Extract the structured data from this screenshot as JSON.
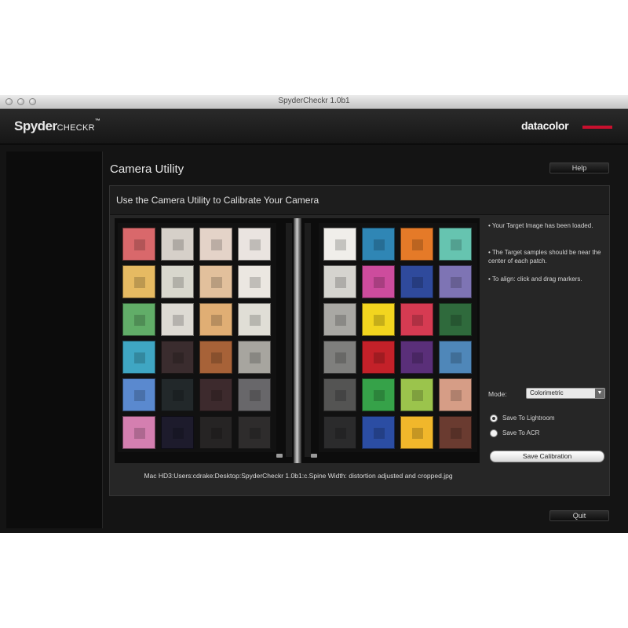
{
  "window": {
    "title": "SpyderCheckr 1.0b1"
  },
  "header": {
    "brand_main": "Spyder",
    "brand_suffix": "CHECKR",
    "brand_tm": "™",
    "vendor": "datacolor"
  },
  "page": {
    "title": "Camera Utility",
    "help_label": "Help",
    "quit_label": "Quit"
  },
  "panel": {
    "title": "Use the Camera Utility to Calibrate Your Camera",
    "file_path": "Mac HD3:Users:cdrake:Desktop:SpyderCheckr 1.0b1:c.Spine Width: distortion adjusted and cropped.jpg"
  },
  "instructions": [
    "• Your Target Image has been loaded.",
    "• The Target samples should be near the center of each patch.",
    "• To align: click and drag markers."
  ],
  "controls": {
    "mode_label": "Mode:",
    "mode_value": "Colorimetric",
    "radio_options": [
      {
        "label": "Save To Lightroom",
        "selected": true
      },
      {
        "label": "Save To ACR",
        "selected": false
      }
    ],
    "save_label": "Save Calibration"
  },
  "colors": {
    "chart_left": [
      [
        "#d9686b",
        "#d6d0c9",
        "#e4d3c8",
        "#eae4e0"
      ],
      [
        "#e6ba62",
        "#d8d7cd",
        "#e2c09c",
        "#ebe7e1"
      ],
      [
        "#61ad68",
        "#dddad3",
        "#e0ae74",
        "#e0ded6"
      ],
      [
        "#3fa6c3",
        "#3a2c2e",
        "#a76238",
        "#a7a59f"
      ],
      [
        "#5a89cf",
        "#22282a",
        "#3d2a2d",
        "#68676a"
      ],
      [
        "#d47fb0",
        "#1d1b2c",
        "#262424",
        "#2e2c2c"
      ]
    ],
    "chart_right": [
      [
        "#f0eeea",
        "#2f86b5",
        "#e57a28",
        "#66c4b0"
      ],
      [
        "#d5d4cf",
        "#cd4c9d",
        "#2f4a9c",
        "#7e74b4"
      ],
      [
        "#a9a8a4",
        "#f2d51f",
        "#d63b52",
        "#2f6a3c"
      ],
      [
        "#7f7f7d",
        "#c42129",
        "#5a2f79",
        "#4f87b9"
      ],
      [
        "#545453",
        "#36a249",
        "#9bc44c",
        "#d69d86"
      ],
      [
        "#2b2b2c",
        "#2b4da3",
        "#f1b72b",
        "#6a3b30"
      ]
    ]
  }
}
